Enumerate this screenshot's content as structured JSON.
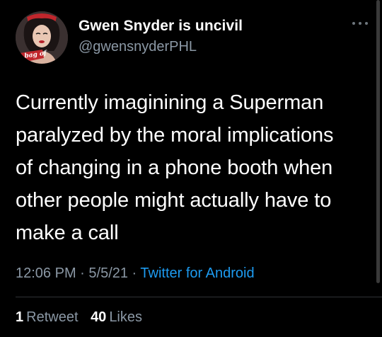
{
  "author": {
    "display_name": "Gwen Snyder is uncivil",
    "handle": "@gwensnyderPHL",
    "avatar_caption": "a bag of"
  },
  "tweet": {
    "line_1": "Currently imaginining a Superman",
    "line_2": "paralyzed by the moral implications",
    "line_3": "of changing in a phone booth when",
    "line_4": "other people might actually have to",
    "line_5": "make a call"
  },
  "meta": {
    "time": "12:06 PM",
    "separator_1": " · ",
    "date": "5/5/21",
    "separator_2": " · ",
    "source": "Twitter for Android"
  },
  "stats": {
    "retweets_count": "1",
    "retweets_label": "Retweet",
    "likes_count": "40",
    "likes_label": "Likes"
  },
  "colors": {
    "background": "#000000",
    "primary_text": "#ffffff",
    "secondary_text": "#8b98a5",
    "link": "#1d9bf0",
    "divider": "#2f3336"
  },
  "icons": {
    "more": "more-horizontal-icon"
  }
}
